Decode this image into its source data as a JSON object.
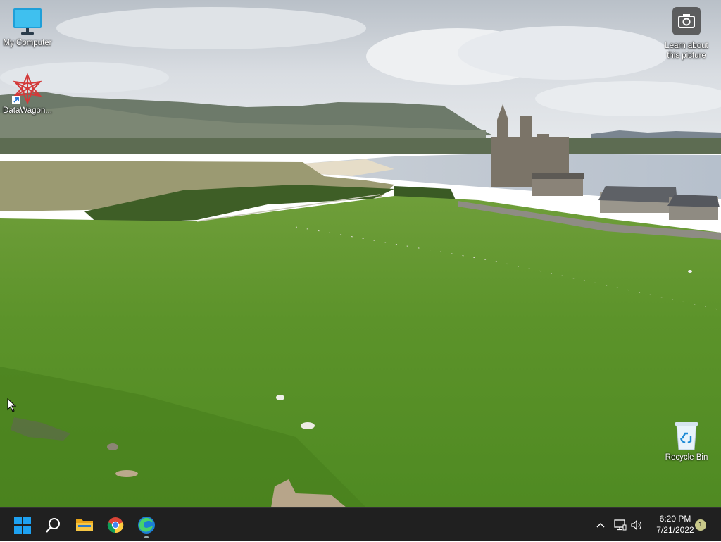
{
  "desktop": {
    "icons": {
      "my_computer": "My Computer",
      "datawagon": "DataWagon...",
      "learn_picture_line1": "Learn about",
      "learn_picture_line2": "this picture",
      "recycle_bin": "Recycle Bin"
    },
    "wallpaper": "landscape-castle-field"
  },
  "taskbar": {
    "apps": [
      {
        "name": "start",
        "icon": "windows-logo-icon"
      },
      {
        "name": "search",
        "icon": "search-icon"
      },
      {
        "name": "file-explorer",
        "icon": "folder-icon"
      },
      {
        "name": "chrome",
        "icon": "chrome-icon"
      },
      {
        "name": "edge",
        "icon": "edge-icon"
      }
    ],
    "tray": {
      "time": "6:20 PM",
      "date": "7/21/2022",
      "notification_count": "1"
    },
    "colors": {
      "background": "#202020",
      "windows_blue": "#0a84d8"
    }
  }
}
